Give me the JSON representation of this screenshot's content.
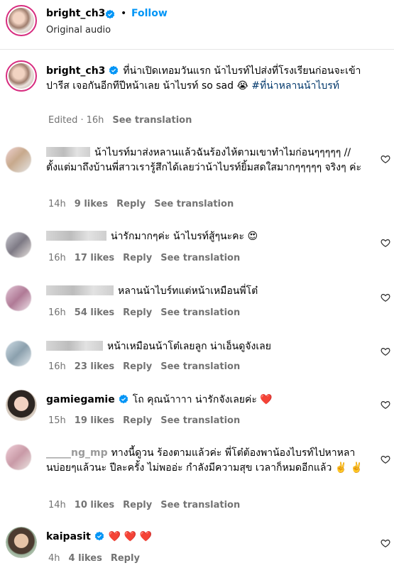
{
  "header": {
    "username": "bright_ch3",
    "dot": "•",
    "follow_label": "Follow",
    "audio": "Original audio"
  },
  "caption": {
    "username": "bright_ch3",
    "text": "ที่น่าเปิดเทอมวันแรก น้าไบรท์ไปส่งที่โรงเรียนก่อนจะเข้าปารีส เจอกันอีกทีปีหน้าเลย น้าไบรท์ so sad 😭",
    "hashtag": "#ที่น่าหลานน้าไบรท์",
    "edited": "Edited",
    "dot": "·",
    "time": "16h",
    "see_translation": "See translation"
  },
  "comments": [
    {
      "text": "น้าไบรท์มาส่งหลานแล้วฉันร้องไห้ตามเขาทำไมก่อนๆๆๆๆๆ // ตั้งแต่มาถึงบ้านพี่สาวเรารู้สึกได้เลยว่าน้าไบรท์ยิ้มสดใสมากๆๆๆๆๆ จริงๆ ค่ะ",
      "time": "14h",
      "likes": "9 likes",
      "reply": "Reply",
      "see_translation": "See translation"
    },
    {
      "text": "น่ารักมากๆค่ะ น้าไบรท์สู้ๆนะคะ 😍",
      "time": "16h",
      "likes": "17 likes",
      "reply": "Reply",
      "see_translation": "See translation"
    },
    {
      "text": "หลานน้าไบร์ทแต่หน้าเหมือนพี่โต๋",
      "time": "16h",
      "likes": "54 likes",
      "reply": "Reply",
      "see_translation": "See translation"
    },
    {
      "text": "หน้าเหมือนน้าโต๋เลยลูก น่าเอ็นดูจังเลย",
      "time": "16h",
      "likes": "23 likes",
      "reply": "Reply",
      "see_translation": "See translation"
    },
    {
      "username": "gamiegamie",
      "text": "โถ คุณน้าาาา น่ารักจังเลยค่ะ ❤️",
      "time": "15h",
      "likes": "19 likes",
      "reply": "Reply",
      "see_translation": "See translation"
    },
    {
      "username": "_____ng_mp",
      "text": "ทางนี้ดูวน ร้องตามแล้วค่ะ พี่โต๋ต้องพาน้องไบรท์ไปหาหลานบ่อยๆแล้วนะ ปีละครั้ง ไม่พออ่ะ กำลังมีความสุข เวลาก็หมดอีกแล้ว ✌️ ✌️",
      "time": "14h",
      "likes": "10 likes",
      "reply": "Reply",
      "see_translation": "See translation"
    },
    {
      "username": "kaipasit",
      "text": "❤️ ❤️ ❤️",
      "time": "4h",
      "likes": "4 likes",
      "reply": "Reply"
    }
  ],
  "colors": {
    "link_blue": "#0095f6",
    "verified_blue": "#0095f6",
    "muted": "#737373",
    "hashtag": "#00376b"
  },
  "icons": {
    "verified": "verified-badge-icon",
    "heart": "heart-outline-icon"
  }
}
